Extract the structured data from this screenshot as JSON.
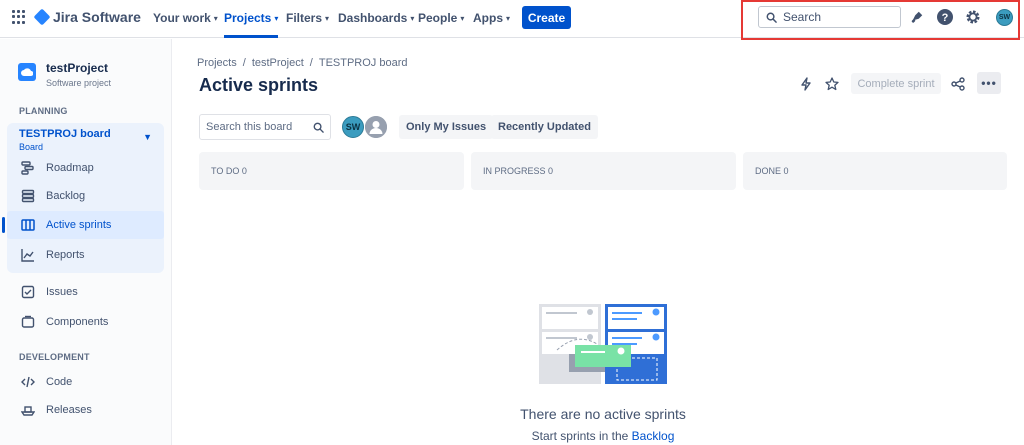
{
  "nav": {
    "product": "Jira Software",
    "items": [
      {
        "label": "Your work"
      },
      {
        "label": "Projects"
      },
      {
        "label": "Filters"
      },
      {
        "label": "Dashboards"
      },
      {
        "label": "People"
      },
      {
        "label": "Apps"
      }
    ],
    "create_label": "Create",
    "search_placeholder": "Search",
    "user_initials": "SW"
  },
  "sidebar": {
    "project_name": "testProject",
    "project_type": "Software project",
    "planning_label": "PLANNING",
    "board_name": "TESTPROJ board",
    "board_sub": "Board",
    "items": [
      {
        "label": "Roadmap",
        "icon": "roadmap-icon"
      },
      {
        "label": "Backlog",
        "icon": "backlog-icon"
      },
      {
        "label": "Active sprints",
        "icon": "board-icon"
      },
      {
        "label": "Reports",
        "icon": "chart-icon"
      },
      {
        "label": "Issues",
        "icon": "issues-icon"
      },
      {
        "label": "Components",
        "icon": "components-icon"
      }
    ],
    "development_label": "DEVELOPMENT",
    "dev_items": [
      {
        "label": "Code",
        "icon": "code-icon"
      },
      {
        "label": "Releases",
        "icon": "ship-icon"
      }
    ]
  },
  "main": {
    "breadcrumb": [
      "Projects",
      "/",
      "testProject",
      "/",
      "TESTPROJ board"
    ],
    "title": "Active sprints",
    "complete_label": "Complete sprint",
    "more_label": "•••",
    "board_search_placeholder": "Search this board",
    "avatar_initials": "SW",
    "filters": [
      "Only My Issues",
      "Recently Updated"
    ],
    "columns": [
      {
        "label": "TO DO 0"
      },
      {
        "label": "IN PROGRESS 0"
      },
      {
        "label": "DONE 0"
      }
    ],
    "empty_title": "There are no active sprints",
    "empty_sub_prefix": "Start sprints in the ",
    "empty_sub_link": "Backlog"
  },
  "colors": {
    "brand": "#0052cc",
    "highlight": "#e53935"
  }
}
